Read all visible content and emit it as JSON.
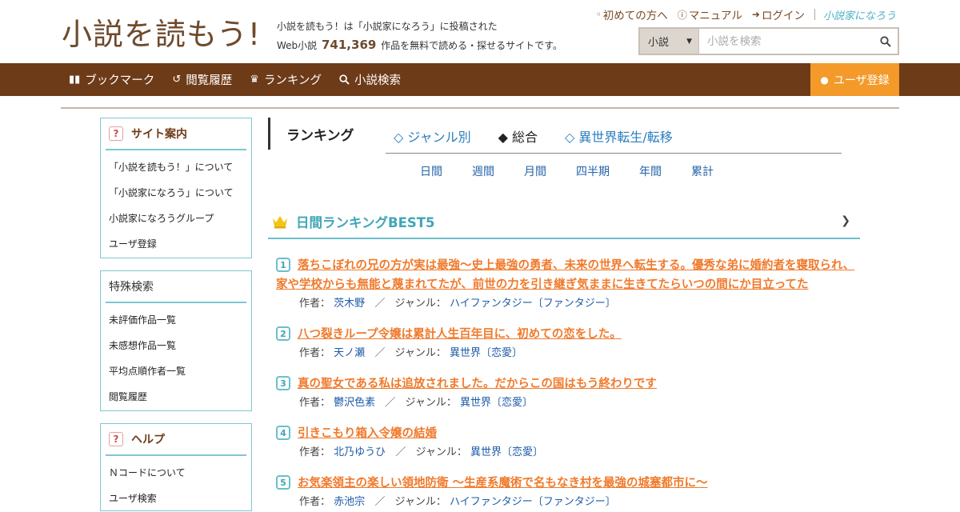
{
  "header": {
    "logo_text": "小説を読もう!",
    "tagline_line1": "小説を読もう！は「小説家になろう」に投稿された",
    "tagline_prefix": "Web小説",
    "novel_count": "741,369",
    "tagline_suffix": "作品を無料で読める・探せるサイトです。",
    "links": [
      {
        "label": "初めての方へ",
        "icon": "book-icon"
      },
      {
        "label": "マニュアル",
        "icon": "help-icon"
      },
      {
        "label": "ログイン",
        "icon": "login-icon"
      }
    ],
    "narou_logo_text": "小説家になろう",
    "search": {
      "select_value": "小説",
      "placeholder": "小説を検索"
    }
  },
  "nav": {
    "items": [
      {
        "label": "ブックマーク",
        "icon": "bookmark-icon"
      },
      {
        "label": "閲覧履歴",
        "icon": "history-icon"
      },
      {
        "label": "ランキング",
        "icon": "crown-icon"
      },
      {
        "label": "小説検索",
        "icon": "search-icon"
      }
    ],
    "register_label": "ユーザ登録"
  },
  "sidebar": {
    "site_guide": {
      "title": "サイト案内",
      "items": [
        "「小説を読もう！」について",
        "「小説家になろう」について",
        "小説家になろうグループ",
        "ユーザ登録"
      ]
    },
    "special_search": {
      "title": "特殊検索",
      "items": [
        "未評価作品一覧",
        "未感想作品一覧",
        "平均点順作者一覧",
        "閲覧履歴"
      ]
    },
    "help": {
      "title": "ヘルプ",
      "items": [
        "Ｎコードについて",
        "ユーザ検索"
      ]
    }
  },
  "ranking": {
    "heading": "ランキング",
    "tabs": [
      "◇ ジャンル別",
      "◆ 総合",
      "◇ 異世界転生/転移"
    ],
    "active_tab": 1,
    "periods": [
      "日間",
      "週間",
      "月間",
      "四半期",
      "年間",
      "累計"
    ],
    "best_title": "日間ランキングBEST5",
    "author_label": "作者：",
    "genre_label": "ジャンル：",
    "entries": [
      {
        "rank": "1",
        "title": "落ちこぼれの兄の方が実は最強〜史上最強の勇者、未来の世界へ転生する。優秀な弟に婚約者を寝取られ、家や学校からも無能と蔑まれてたが、前世の力を引き継ぎ気ままに生きてたらいつの間にか目立ってた",
        "author": "茨木野",
        "genre": "ハイファンタジー〔ファンタジー〕"
      },
      {
        "rank": "2",
        "title": "八つ裂きループ令嬢は累計人生百年目に、初めての恋をした。",
        "author": "天ノ瀬",
        "genre": "異世界〔恋愛〕"
      },
      {
        "rank": "3",
        "title": "真の聖女である私は追放されました。だからこの国はもう終わりです",
        "author": "鬱沢色素",
        "genre": "異世界〔恋愛〕"
      },
      {
        "rank": "4",
        "title": "引きこもり箱入令嬢の結婚",
        "author": "北乃ゆうひ",
        "genre": "異世界〔恋愛〕"
      },
      {
        "rank": "5",
        "title": "お気楽領主の楽しい領地防衛 〜生産系魔術で名もなき村を最強の城塞都市に〜",
        "author": "赤池宗",
        "genre": "ハイファンタジー〔ファンタジー〕"
      }
    ]
  },
  "colors": {
    "brand_brown": "#6e3b18",
    "accent_orange": "#f39a2b",
    "title_orange": "#f07a2c",
    "teal": "#3fa6b6",
    "link_blue": "#1e5ba8"
  }
}
